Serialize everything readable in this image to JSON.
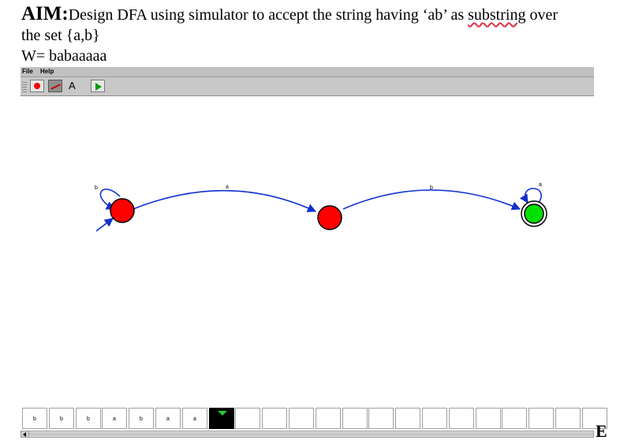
{
  "document": {
    "aim_label": "AIM:",
    "aim_text_part1": "Design DFA using simulator to accept the string having ‘ab’ as ",
    "aim_text_spell": "substring",
    "aim_text_part2": " over",
    "aim_text_line2": "the set {a,b}",
    "w_line": "W= babaaaaa",
    "trailing_label": "E"
  },
  "simulator": {
    "menu": {
      "file": "File",
      "help": "Help"
    },
    "toolbar": {
      "tools": [
        "state-tool",
        "transition-tool",
        "text-tool",
        "run-tool"
      ],
      "pressed": "transition-tool",
      "text_tool_glyph": "A"
    },
    "dfa": {
      "states": [
        {
          "id": "q0",
          "initial": true,
          "final": false,
          "color": "#ff0000"
        },
        {
          "id": "q1",
          "initial": false,
          "final": false,
          "color": "#ff0000"
        },
        {
          "id": "q2",
          "initial": false,
          "final": true,
          "color": "#00e000"
        }
      ],
      "transitions": [
        {
          "from": "q0",
          "to": "q0",
          "label": "b"
        },
        {
          "from": "q0",
          "to": "q1",
          "label": "a"
        },
        {
          "from": "q1",
          "to": "q2",
          "label": "b"
        },
        {
          "from": "q2",
          "to": "q2",
          "label": "a"
        }
      ],
      "edge_color": "#1030d0"
    },
    "tape": {
      "cells": [
        "b",
        "b",
        "b",
        "a",
        "b",
        "a",
        "a",
        "",
        "",
        "",
        "",
        "",
        "",
        "",
        "",
        "",
        "",
        "",
        "",
        "",
        "",
        ""
      ],
      "head_index": 7,
      "head_marker_color": "#22cc33"
    }
  }
}
